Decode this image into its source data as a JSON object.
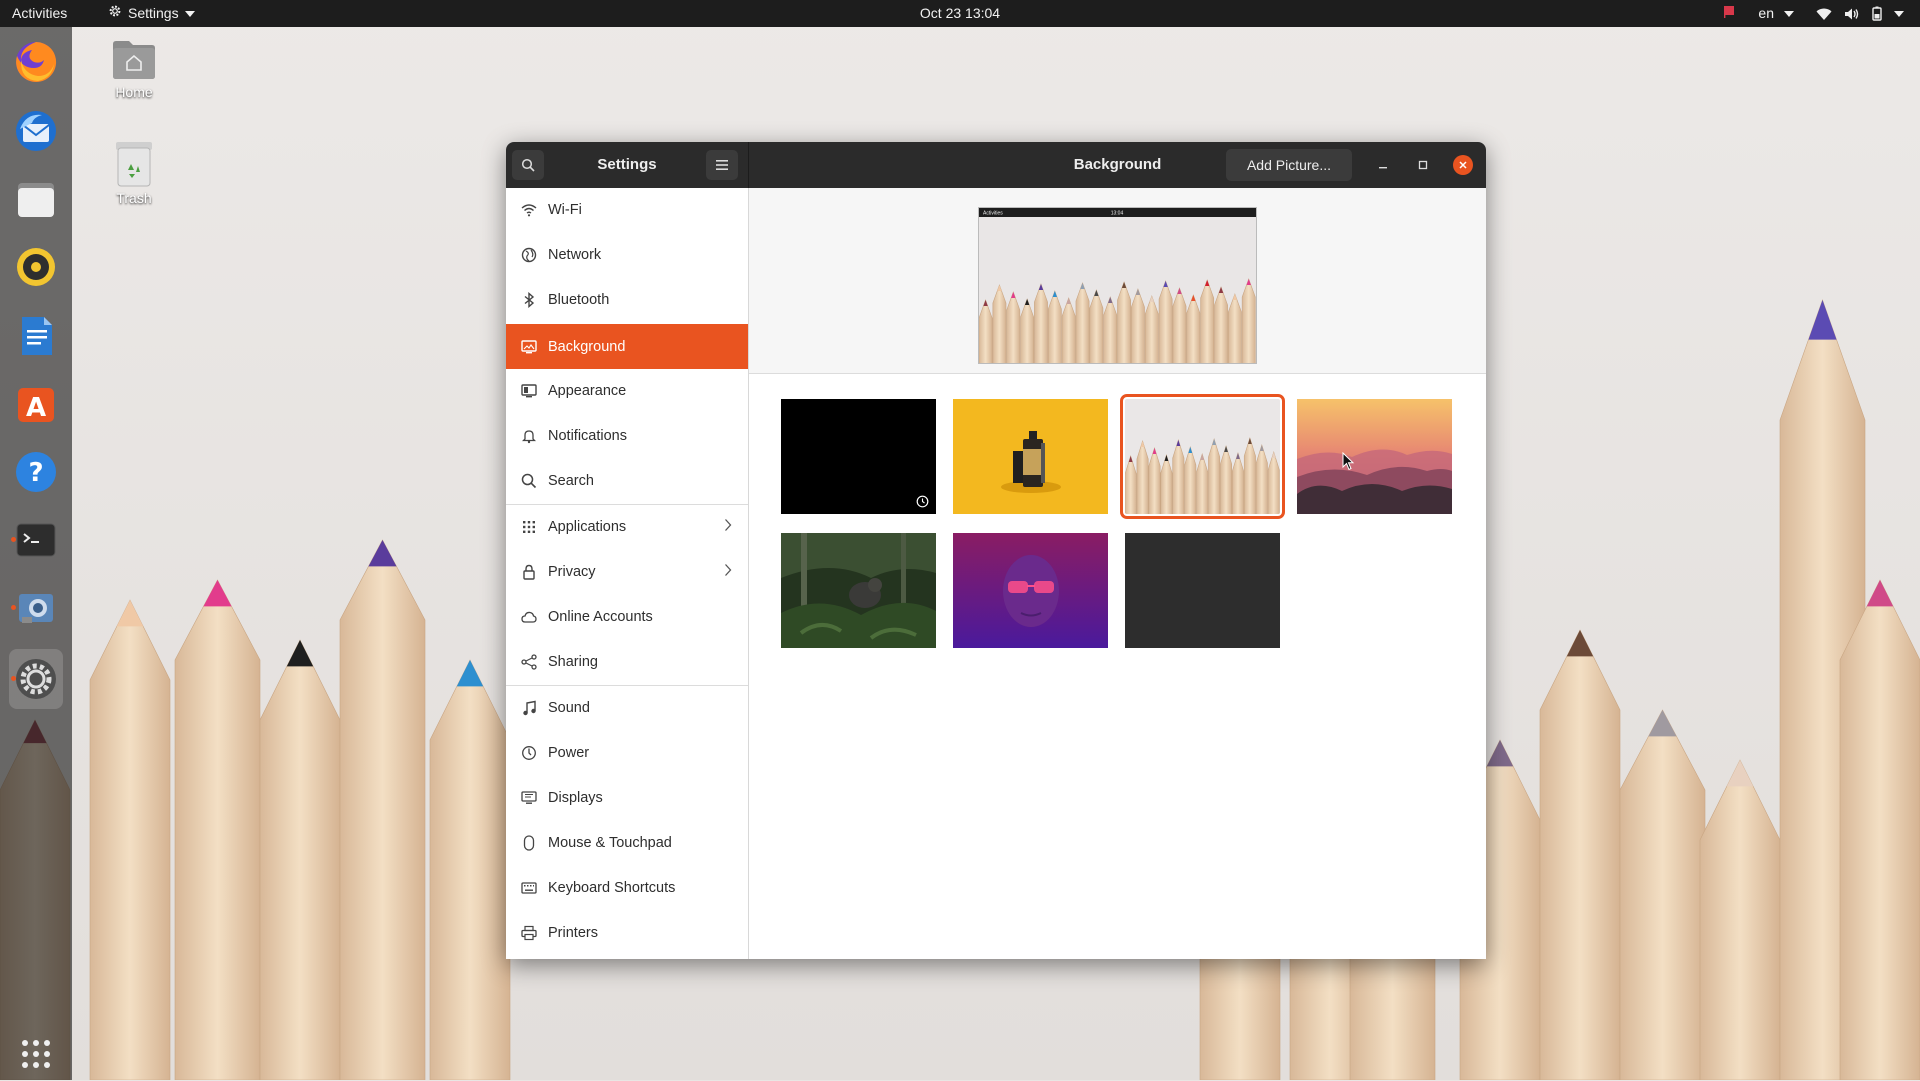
{
  "topbar": {
    "activities": "Activities",
    "app_menu": "Settings",
    "clock": "Oct 23  13:04",
    "keyboard_layout": "en"
  },
  "dock": {
    "items": [
      {
        "name": "Firefox",
        "icon": "firefox-icon"
      },
      {
        "name": "Thunderbird",
        "icon": "thunderbird-icon"
      },
      {
        "name": "Files",
        "icon": "files-icon"
      },
      {
        "name": "Rhythmbox",
        "icon": "rhythmbox-icon"
      },
      {
        "name": "LibreOffice Writer",
        "icon": "writer-icon"
      },
      {
        "name": "Ubuntu Software",
        "icon": "software-icon"
      },
      {
        "name": "Help",
        "icon": "help-icon"
      },
      {
        "name": "Terminal",
        "icon": "terminal-icon"
      },
      {
        "name": "Screenshot",
        "icon": "screenshot-icon"
      },
      {
        "name": "Settings",
        "icon": "settings-icon"
      },
      {
        "name": "Show Applications",
        "icon": "app-grid-icon"
      }
    ]
  },
  "desktop": {
    "home_label": "Home",
    "trash_label": "Trash"
  },
  "window": {
    "sidebar_title": "Settings",
    "page_title": "Background",
    "add_picture": "Add Picture..."
  },
  "sidebar": {
    "items": [
      {
        "label": "Wi-Fi",
        "icon": "wifi-icon"
      },
      {
        "label": "Network",
        "icon": "network-icon"
      },
      {
        "label": "Bluetooth",
        "icon": "bluetooth-icon"
      },
      {
        "label": "Background",
        "icon": "background-icon"
      },
      {
        "label": "Appearance",
        "icon": "appearance-icon"
      },
      {
        "label": "Notifications",
        "icon": "bell-icon"
      },
      {
        "label": "Search",
        "icon": "search-icon"
      },
      {
        "label": "Applications",
        "icon": "applications-icon"
      },
      {
        "label": "Privacy",
        "icon": "lock-icon"
      },
      {
        "label": "Online Accounts",
        "icon": "cloud-icon"
      },
      {
        "label": "Sharing",
        "icon": "share-icon"
      },
      {
        "label": "Sound",
        "icon": "music-note-icon"
      },
      {
        "label": "Power",
        "icon": "power-icon"
      },
      {
        "label": "Displays",
        "icon": "display-icon"
      },
      {
        "label": "Mouse & Touchpad",
        "icon": "mouse-icon"
      },
      {
        "label": "Keyboard Shortcuts",
        "icon": "keyboard-icon"
      },
      {
        "label": "Printers",
        "icon": "printer-icon"
      }
    ]
  },
  "preview": {
    "mini_activities": "Activities",
    "mini_clock": "13:04"
  },
  "colors": {
    "accent": "#e95420",
    "headerbar": "#2b2b2b",
    "topbar": "#1d1d1d"
  }
}
